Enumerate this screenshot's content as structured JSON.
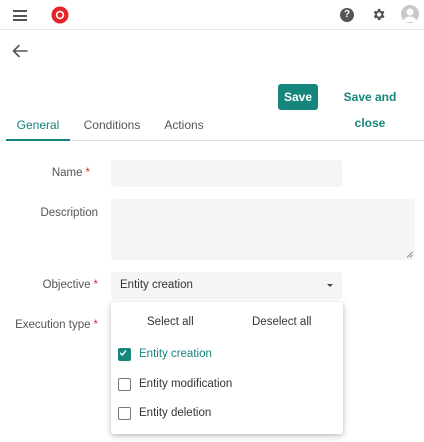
{
  "header": {
    "menu_icon": "hamburger-menu-icon",
    "logo_icon": "app-logo-icon",
    "help_icon_glyph": "?",
    "settings_icon": "gear-icon",
    "avatar_icon": "user-avatar-icon"
  },
  "toolbar": {
    "back_icon": "arrow-left-icon",
    "save_label": "Save",
    "save_close_label": "Save and close"
  },
  "tabs": [
    {
      "label": "General",
      "active": true
    },
    {
      "label": "Conditions",
      "active": false
    },
    {
      "label": "Actions",
      "active": false
    }
  ],
  "form": {
    "name_label": "Name",
    "required_mark": "*",
    "name_value": "",
    "description_label": "Description",
    "description_value": "",
    "objective_label": "Objective",
    "objective_value": "Entity creation",
    "execution_type_label": "Execution type"
  },
  "dropdown": {
    "select_all_label": "Select all",
    "deselect_all_label": "Deselect all",
    "options": [
      {
        "label": "Entity creation",
        "checked": true
      },
      {
        "label": "Entity modification",
        "checked": false
      },
      {
        "label": "Entity deletion",
        "checked": false
      }
    ]
  },
  "colors": {
    "accent": "#16857c",
    "required": "#d32f2f",
    "field_bg": "#f5f5f5"
  }
}
